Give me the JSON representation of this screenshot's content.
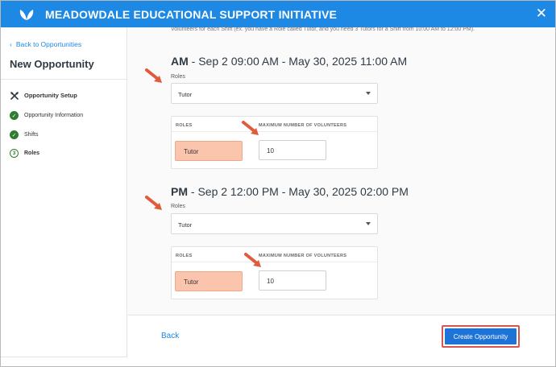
{
  "header": {
    "org_title": "MEADOWDALE EDUCATIONAL SUPPORT INITIATIVE",
    "close_glyph": "✕"
  },
  "sidebar": {
    "back_label": "Back to Opportunities",
    "page_title": "New Opportunity",
    "steps": [
      {
        "label": "Opportunity Setup",
        "state": "section"
      },
      {
        "label": "Opportunity Information",
        "state": "done"
      },
      {
        "label": "Shifts",
        "state": "done"
      },
      {
        "label": "Roles",
        "state": "current",
        "number": "3"
      }
    ]
  },
  "main": {
    "intro": "Volunteers for each Shift (ex. you have a Role called Tutor, and you need 3 Tutors for a Shift from 10:00 AM to 12:00 PM).",
    "shifts": [
      {
        "name": "AM",
        "range": " - Sep 2 09:00 AM - May 30, 2025 11:00 AM",
        "roles_label": "Roles",
        "selected_role": "Tutor",
        "col_roles": "ROLES",
        "col_max": "MAXIMUM NUMBER OF VOLUNTEERS",
        "role_name": "Tutor",
        "max_volunteers": "10"
      },
      {
        "name": "PM",
        "range": " - Sep 2 12:00 PM - May 30, 2025 02:00 PM",
        "roles_label": "Roles",
        "selected_role": "Tutor",
        "col_roles": "ROLES",
        "col_max": "MAXIMUM NUMBER OF VOLUNTEERS",
        "role_name": "Tutor",
        "max_volunteers": "10"
      }
    ]
  },
  "footer": {
    "back_label": "Back",
    "create_label": "Create Opportunity"
  },
  "colors": {
    "header": "#1e88e5",
    "accent": "#1e74d6",
    "success": "#2e7d32",
    "chip": "#fbc4ad",
    "annotation": "#e05a3c"
  },
  "icons": {
    "logo": "leaf-logo-icon",
    "close": "close-icon",
    "back": "chevron-left-icon",
    "setup": "tools-icon",
    "done": "check-circle-icon",
    "dropdown": "caret-down-icon",
    "annotation": "red-arrow-icon"
  }
}
